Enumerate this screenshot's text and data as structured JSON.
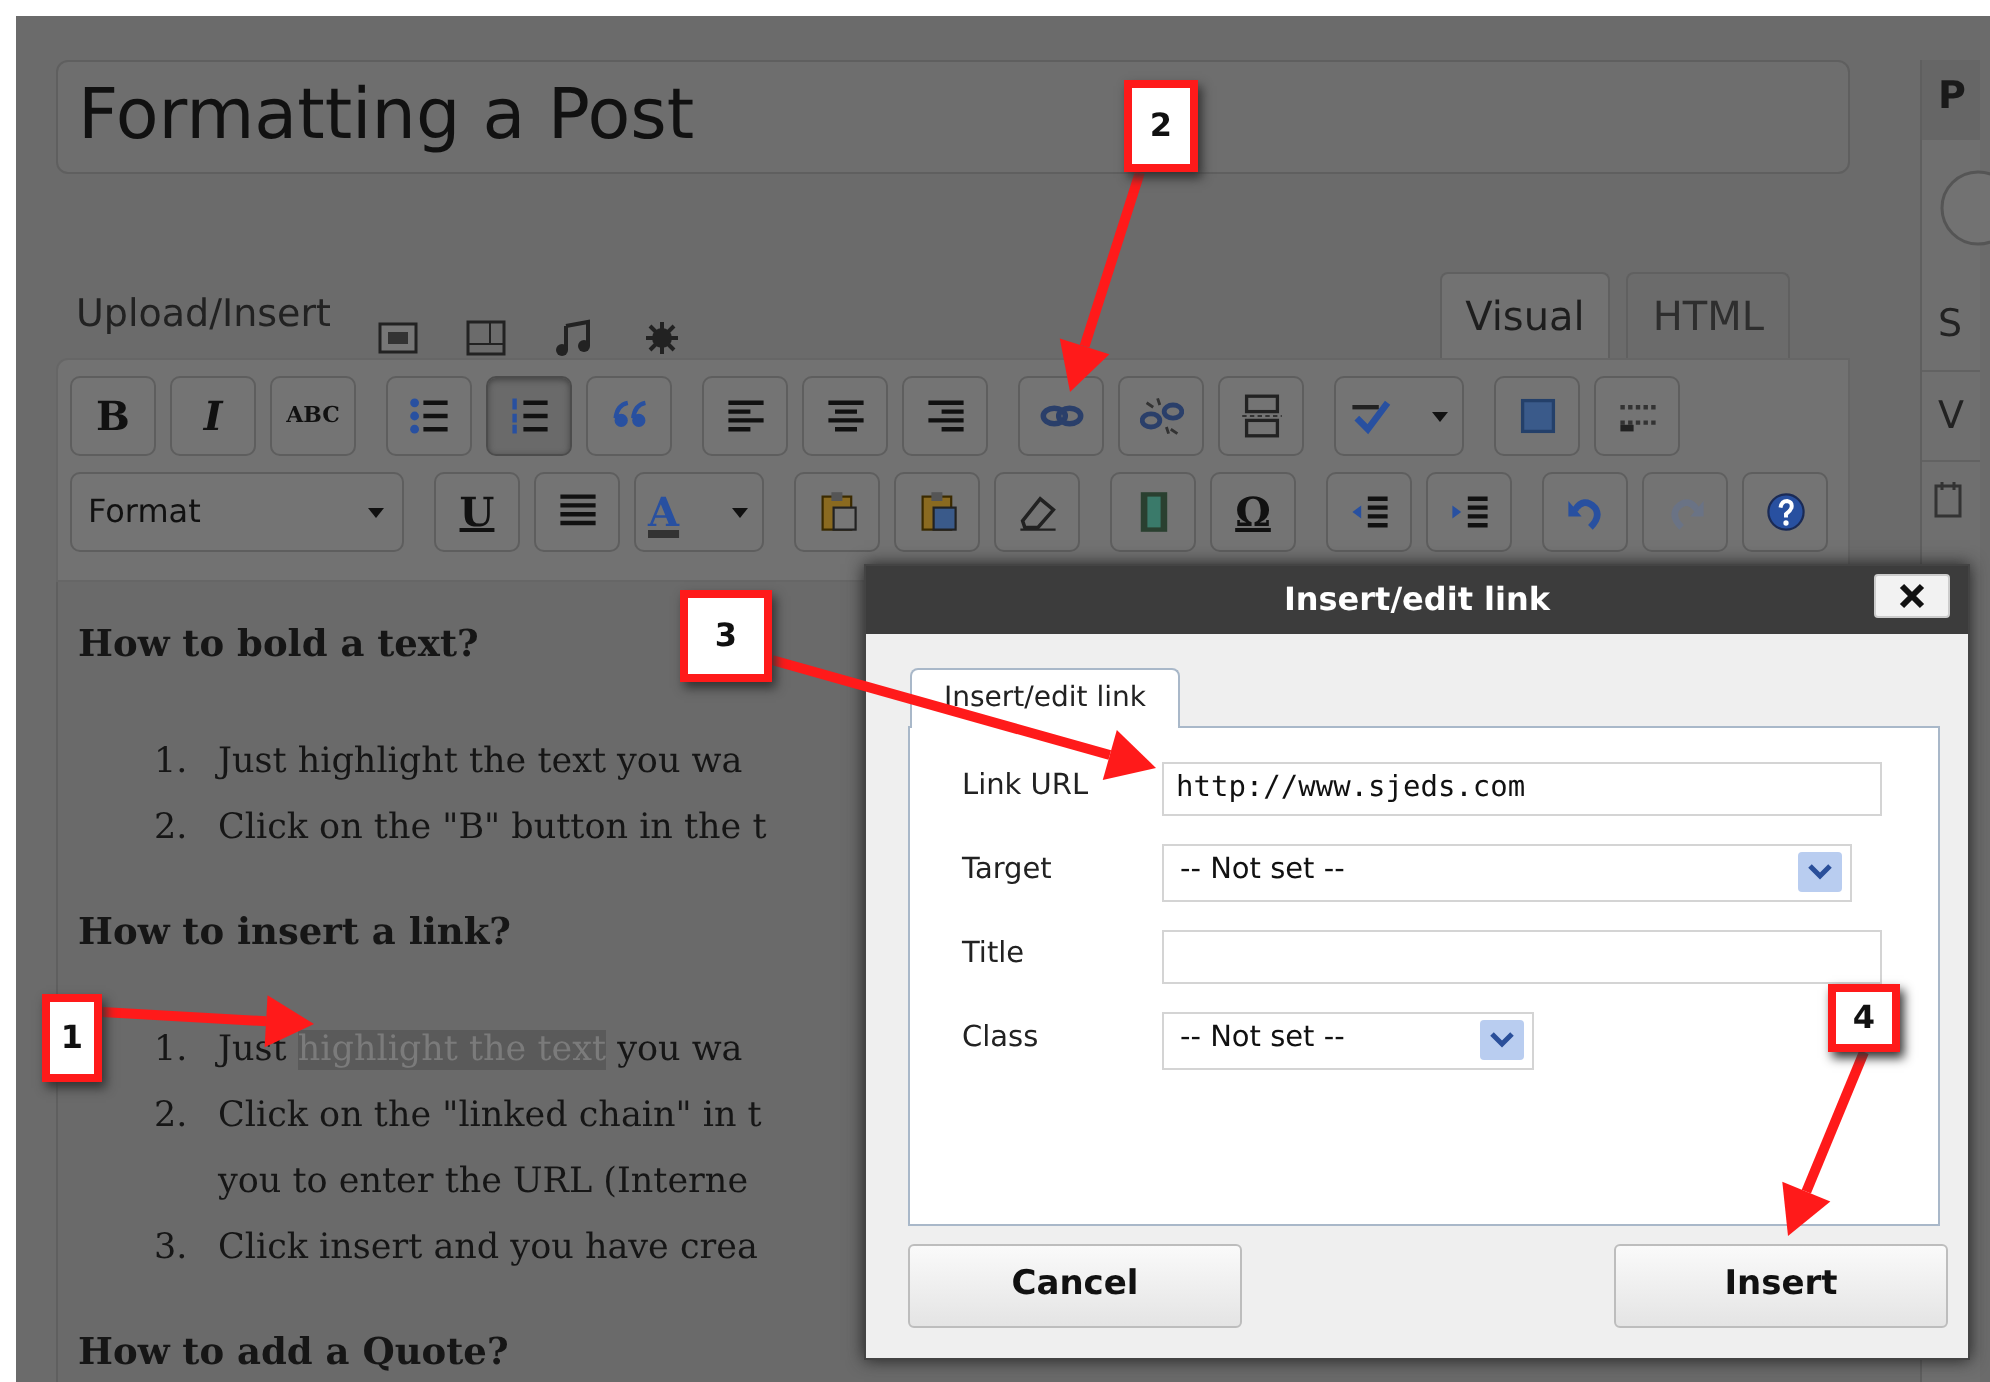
{
  "title": "Formatting a Post",
  "media": {
    "label": "Upload/Insert"
  },
  "editor_tabs": [
    {
      "label": "Visual",
      "selected": true
    },
    {
      "label": "HTML",
      "selected": false
    }
  ],
  "toolbar_rows": [
    [
      {
        "kind": "glyph",
        "label": "B",
        "active": false
      },
      {
        "kind": "glyph",
        "label": "I",
        "active": false
      },
      {
        "kind": "glyph",
        "label": "ABC",
        "active": false
      },
      {
        "kind": "icon",
        "active": false
      },
      {
        "kind": "icon",
        "active": true
      },
      {
        "kind": "icon",
        "active": false
      },
      {
        "kind": "icon",
        "active": false
      },
      {
        "kind": "icon",
        "active": false
      },
      {
        "kind": "icon",
        "active": false
      },
      {
        "kind": "icon",
        "active": false
      },
      {
        "kind": "icon",
        "active": false
      },
      {
        "kind": "icon",
        "active": false
      },
      {
        "kind": "split",
        "active": false
      },
      {
        "kind": "icon",
        "active": false
      },
      {
        "kind": "icon",
        "active": false
      }
    ],
    [
      {
        "kind": "select",
        "label": "Format",
        "active": false
      },
      {
        "kind": "glyph",
        "label": "U",
        "active": false
      },
      {
        "kind": "icon",
        "active": false
      },
      {
        "kind": "split",
        "label": "A",
        "active": false
      },
      {
        "kind": "icon",
        "active": false
      },
      {
        "kind": "icon",
        "active": false
      },
      {
        "kind": "icon",
        "active": false
      },
      {
        "kind": "icon",
        "active": false
      },
      {
        "kind": "glyph",
        "label": "Ω",
        "active": false
      },
      {
        "kind": "icon",
        "active": false
      },
      {
        "kind": "icon",
        "active": false
      },
      {
        "kind": "icon",
        "active": false
      },
      {
        "kind": "icon",
        "active": false,
        "disabled": true
      },
      {
        "kind": "icon",
        "active": false
      }
    ]
  ],
  "content": [
    {
      "heading": "How to bold a text?",
      "items": [
        {
          "number": "1.",
          "lines": [
            [
              {
                "text": "Just highlight the text you wa",
                "highlighted": false
              }
            ]
          ]
        },
        {
          "number": "2.",
          "lines": [
            [
              {
                "text": "Click on the \"B\" button in the t",
                "highlighted": false
              }
            ]
          ]
        }
      ]
    },
    {
      "heading": "How to insert a link?",
      "items": [
        {
          "number": "1.",
          "lines": [
            [
              {
                "text": "Just ",
                "highlighted": false
              },
              {
                "text": "highlight the text",
                "highlighted": true
              },
              {
                "text": " you wa",
                "highlighted": false
              }
            ]
          ]
        },
        {
          "number": "2.",
          "lines": [
            [
              {
                "text": "Click on the \"linked chain\" in t",
                "highlighted": false
              }
            ],
            [
              {
                "text": "you to enter the URL (Interne",
                "highlighted": false
              }
            ]
          ]
        },
        {
          "number": "3.",
          "lines": [
            [
              {
                "text": "Click insert and you have crea",
                "highlighted": false
              }
            ]
          ]
        }
      ]
    },
    {
      "heading": "How to add a Quote?"
    }
  ],
  "sidebar": {
    "heading": "P",
    "labels": [
      "S",
      "V"
    ]
  },
  "dialog": {
    "title": "Insert/edit link",
    "tabs": [
      {
        "label": "Insert/edit link",
        "selected": true
      }
    ],
    "fields": [
      {
        "kind": "input",
        "label": "Link URL",
        "value": "http://www.sjeds.com"
      },
      {
        "kind": "select",
        "label": "Target",
        "value": "-- Not set --"
      },
      {
        "kind": "input",
        "label": "Title"
      },
      {
        "kind": "select",
        "label": "Class",
        "value": "-- Not set --"
      }
    ],
    "buttons": [
      {
        "label": "Cancel"
      },
      {
        "label": "Insert"
      }
    ]
  },
  "callouts": [
    {
      "label": "2"
    },
    {
      "label": "3"
    },
    {
      "label": "1"
    },
    {
      "label": "4"
    }
  ]
}
